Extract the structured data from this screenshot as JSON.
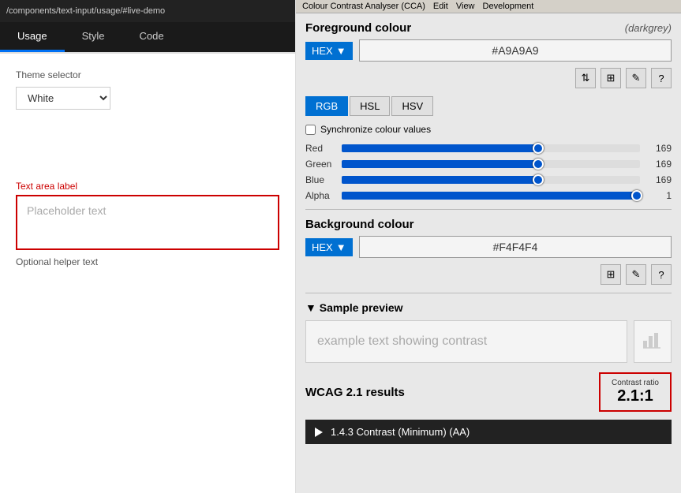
{
  "url": "/components/text-input/usage/#live-demo",
  "left": {
    "tabs": [
      {
        "label": "Usage",
        "active": true
      },
      {
        "label": "Style",
        "active": false
      },
      {
        "label": "Code",
        "active": false
      }
    ],
    "theme_label": "Theme selector",
    "theme_value": "White",
    "textarea_label": "Text area label",
    "placeholder": "Placeholder text",
    "helper_text": "Optional helper text"
  },
  "cca": {
    "menu_items": [
      "Colour Contrast Analyser (CCA)",
      "Edit",
      "View",
      "Development"
    ],
    "foreground": {
      "title": "Foreground colour",
      "hint": "(darkgrey)",
      "format": "HEX",
      "value": "#A9A9A9",
      "model_tabs": [
        "RGB",
        "HSL",
        "HSV"
      ],
      "active_model": "RGB",
      "sync_label": "Synchronize colour values",
      "channels": [
        {
          "label": "Red",
          "value": 169,
          "pct": 66
        },
        {
          "label": "Green",
          "value": 169,
          "pct": 66
        },
        {
          "label": "Blue",
          "value": 169,
          "pct": 66
        },
        {
          "label": "Alpha",
          "value": 1,
          "pct": 99
        }
      ]
    },
    "background": {
      "title": "Background colour",
      "format": "HEX",
      "value": "#F4F4F4"
    },
    "sample_preview": {
      "title": "▼ Sample preview",
      "sample_text": "example text showing contrast",
      "chart_icon": "📊"
    },
    "wcag": {
      "title": "WCAG 2.1 results",
      "contrast_label": "Contrast ratio",
      "contrast_value": "2.1:1",
      "criterion_label": "1.4.3 Contrast (Minimum) (AA)"
    },
    "icons": {
      "swap": "⇅",
      "sliders": "⊞",
      "eyedropper": "✎",
      "help": "?"
    }
  }
}
